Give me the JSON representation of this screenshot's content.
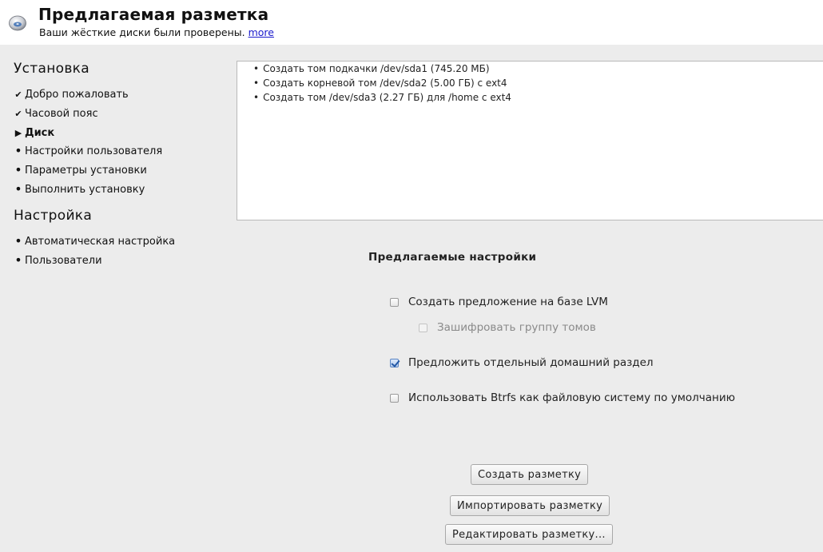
{
  "header": {
    "title": "Предлагаемая разметка",
    "subtitle": "Ваши жёсткие диски были проверены.",
    "more_link": "more",
    "icon": "disk-icon"
  },
  "sidebar": {
    "install_heading": "Установка",
    "install_items": [
      {
        "label": "Добро пожаловать",
        "state": "done"
      },
      {
        "label": "Часовой пояс",
        "state": "done"
      },
      {
        "label": "Диск",
        "state": "current"
      },
      {
        "label": "Настройки пользователя",
        "state": "pending"
      },
      {
        "label": "Параметры установки",
        "state": "pending"
      },
      {
        "label": "Выполнить установку",
        "state": "pending"
      }
    ],
    "config_heading": "Настройка",
    "config_items": [
      {
        "label": "Автоматическая настройка",
        "state": "pending"
      },
      {
        "label": "Пользователи",
        "state": "pending"
      }
    ]
  },
  "summary": {
    "items": [
      "Создать том подкачки /dev/sda1 (745.20 МБ)",
      "Создать корневой том /dev/sda2 (5.00 ГБ) с ext4",
      "Создать том /dev/sda3 (2.27 ГБ) для /home с ext4"
    ]
  },
  "options": {
    "title": "Предлагаемые настройки",
    "lvm": {
      "label": "Создать предложение на базе LVM",
      "checked": false
    },
    "encrypt": {
      "label": "Зашифровать группу томов",
      "checked": false,
      "disabled": true
    },
    "home": {
      "label": "Предложить отдельный домашний раздел",
      "checked": true
    },
    "btrfs": {
      "label": "Использовать Btrfs как файловую систему по умолчанию",
      "checked": false
    }
  },
  "buttons": {
    "create": "Создать разметку",
    "import": "Импортировать разметку",
    "edit": "Редактировать разметку..."
  }
}
